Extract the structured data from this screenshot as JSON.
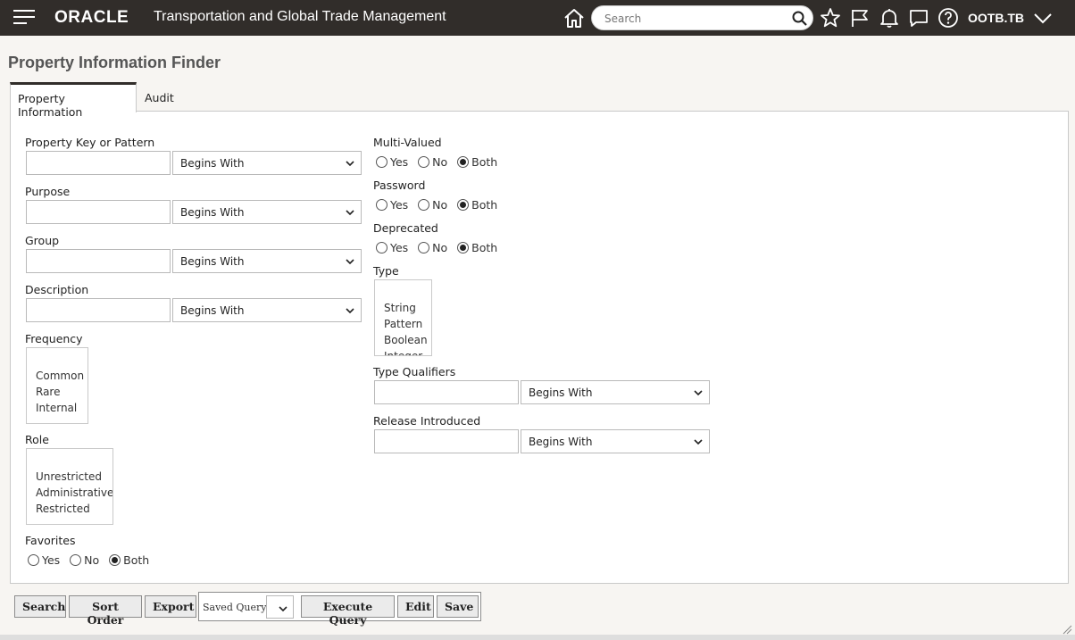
{
  "header": {
    "logo": "ORACLE",
    "app_title": "Transportation and Global Trade Management",
    "search_placeholder": "Search",
    "user": "OOTB.TB"
  },
  "page": {
    "title": "Property Information Finder"
  },
  "tabs": [
    {
      "label": "Property Information",
      "active": true
    },
    {
      "label": "Audit",
      "active": false
    }
  ],
  "left_fields": {
    "property_key": {
      "label": "Property Key or Pattern",
      "value": "",
      "operator": "Begins With"
    },
    "purpose": {
      "label": "Purpose",
      "value": "",
      "operator": "Begins With"
    },
    "group": {
      "label": "Group",
      "value": "",
      "operator": "Begins With"
    },
    "description": {
      "label": "Description",
      "value": "",
      "operator": "Begins With"
    },
    "frequency": {
      "label": "Frequency",
      "options": [
        "Common",
        "Rare",
        "Internal"
      ]
    },
    "role": {
      "label": "Role",
      "options": [
        "Unrestricted",
        "Administrative",
        "Restricted"
      ]
    },
    "favorites": {
      "label": "Favorites",
      "options": [
        "Yes",
        "No",
        "Both"
      ],
      "selected": "Both"
    }
  },
  "right_fields": {
    "multi_valued": {
      "label": "Multi-Valued",
      "options": [
        "Yes",
        "No",
        "Both"
      ],
      "selected": "Both"
    },
    "password": {
      "label": "Password",
      "options": [
        "Yes",
        "No",
        "Both"
      ],
      "selected": "Both"
    },
    "deprecated": {
      "label": "Deprecated",
      "options": [
        "Yes",
        "No",
        "Both"
      ],
      "selected": "Both"
    },
    "type": {
      "label": "Type",
      "options": [
        "String",
        "Pattern",
        "Boolean",
        "Integer"
      ]
    },
    "type_qualifiers": {
      "label": "Type Qualifiers",
      "value": "",
      "operator": "Begins With"
    },
    "release_introduced": {
      "label": "Release Introduced",
      "value": "",
      "operator": "Begins With"
    }
  },
  "footer": {
    "search": "Search",
    "sort_order": "Sort Order",
    "export": "Export",
    "saved_query_label": "Saved Query:",
    "saved_query_value": "",
    "execute_query": "Execute Query",
    "edit": "Edit",
    "save": "Save"
  },
  "colors": {
    "header_bg": "#312d2a",
    "page_bg": "#f7f5f2",
    "panel_bg": "#ffffff"
  }
}
